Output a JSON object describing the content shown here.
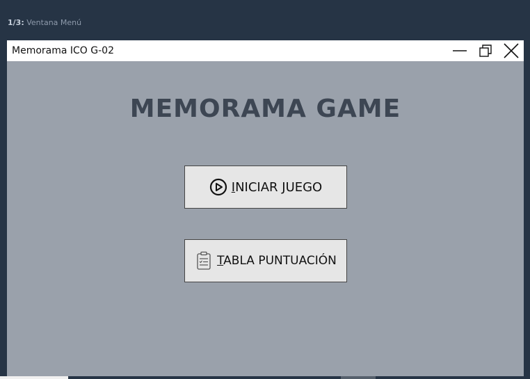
{
  "step": {
    "number": "1/3:",
    "text": "Ventana Menú"
  },
  "window": {
    "title": "Memorama ICO G-02",
    "controls": [
      "minimize-icon",
      "restore-icon",
      "close-icon"
    ]
  },
  "main": {
    "heading": "MEMORAMA GAME",
    "buttons": [
      {
        "mnemonic": "I",
        "rest": "NICIAR JUEGO",
        "icon": "play-circle-icon"
      },
      {
        "mnemonic": "T",
        "rest": "ABLA PUNTUACIÓN",
        "icon": "clipboard-list-icon"
      }
    ]
  },
  "colors": {
    "outer_background": "#263445",
    "window_background": "#9aa1ab",
    "heading": "#3d4653",
    "button_background": "#e6e6e6"
  }
}
